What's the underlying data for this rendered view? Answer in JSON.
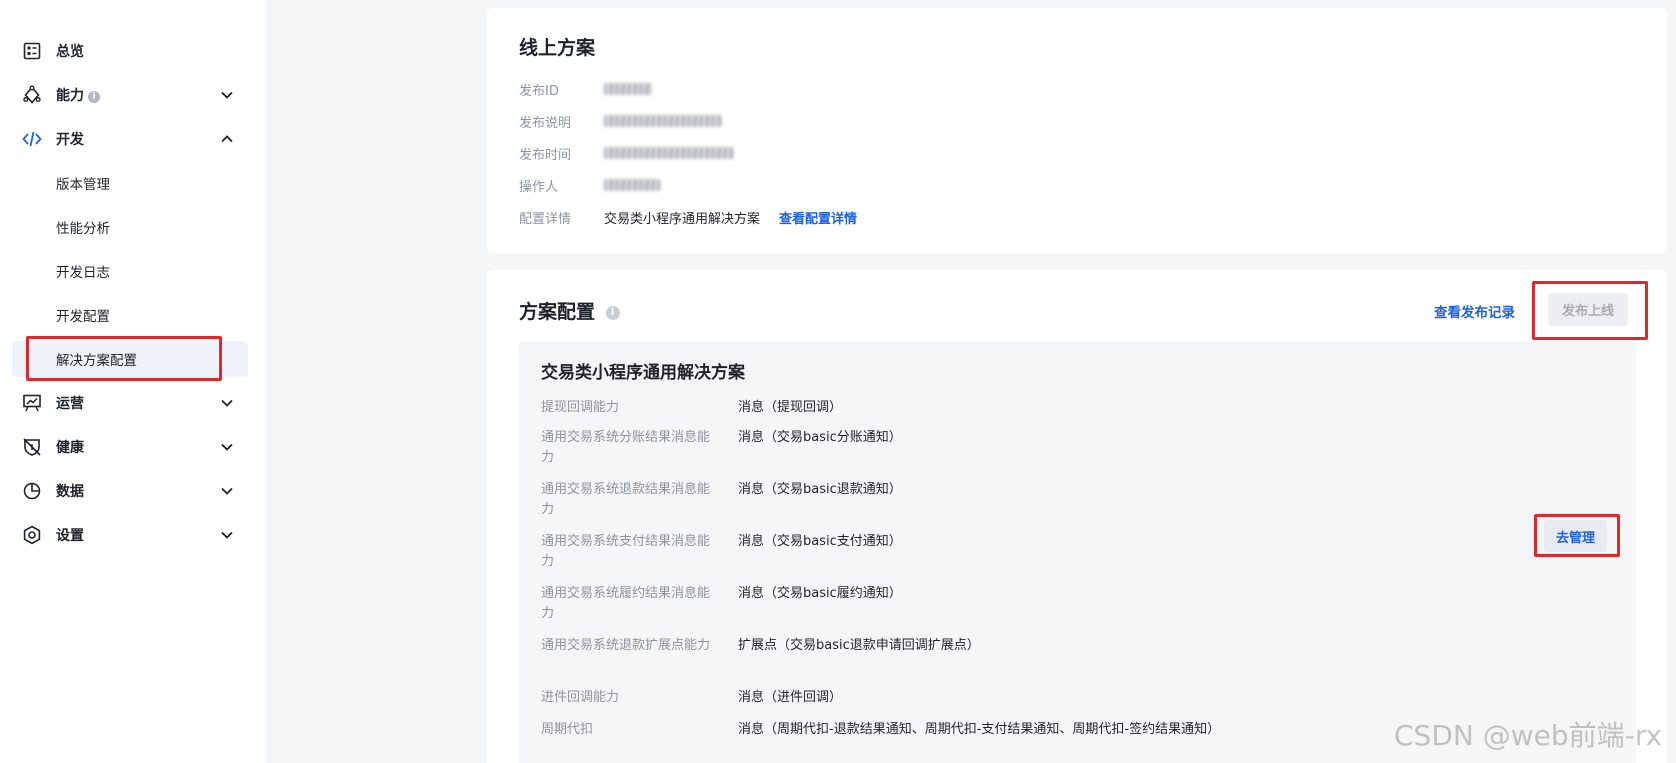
{
  "sidebar": {
    "overview": {
      "label": "总览",
      "icon": "overview-icon"
    },
    "ability": {
      "label": "能力",
      "icon": "ability-icon",
      "info": "i"
    },
    "dev": {
      "label": "开发",
      "icon": "code-icon",
      "children": [
        {
          "label": "版本管理"
        },
        {
          "label": "性能分析"
        },
        {
          "label": "开发日志"
        },
        {
          "label": "开发配置"
        },
        {
          "label": "解决方案配置",
          "active": true
        }
      ]
    },
    "ops": {
      "label": "运营",
      "icon": "presentation-icon"
    },
    "health": {
      "label": "健康",
      "icon": "health-shield-icon"
    },
    "data": {
      "label": "数据",
      "icon": "pie-chart-icon"
    },
    "settings": {
      "label": "设置",
      "icon": "gear-icon"
    }
  },
  "online_plan": {
    "title": "线上方案",
    "fields": [
      {
        "label": "发布ID"
      },
      {
        "label": "发布说明"
      },
      {
        "label": "发布时间"
      },
      {
        "label": "操作人"
      },
      {
        "label": "配置详情",
        "value": "交易类小程序通用解决方案",
        "link": "查看配置详情"
      }
    ]
  },
  "plan_config": {
    "title": "方案配置",
    "info": "i",
    "view_records": "查看发布记录",
    "publish_button": "发布上线",
    "solution_name": "交易类小程序通用解决方案",
    "manage_button": "去管理",
    "capabilities": [
      {
        "label": "提现回调能力",
        "value": "消息（提现回调）"
      },
      {
        "label": "通用交易系统分账结果消息能力",
        "value": "消息（交易basic分账通知）"
      },
      {
        "label": "通用交易系统退款结果消息能力",
        "value": "消息（交易basic退款通知）"
      },
      {
        "label": "通用交易系统支付结果消息能力",
        "value": "消息（交易basic支付通知）"
      },
      {
        "label": "通用交易系统履约结果消息能力",
        "value": "消息（交易basic履约通知）"
      },
      {
        "label": "通用交易系统退款扩展点能力",
        "value": "扩展点（交易basic退款申请回调扩展点）"
      },
      {
        "label": "进件回调能力",
        "value": "消息（进件回调）"
      },
      {
        "label": "周期代扣",
        "value": "消息（周期代扣-退款结果通知、周期代扣-支付结果通知、周期代扣-签约结果通知）"
      }
    ]
  },
  "watermark": "CSDN @web前端-rx",
  "colors": {
    "accent": "#1e62e6",
    "highlight": "#e0272b"
  }
}
